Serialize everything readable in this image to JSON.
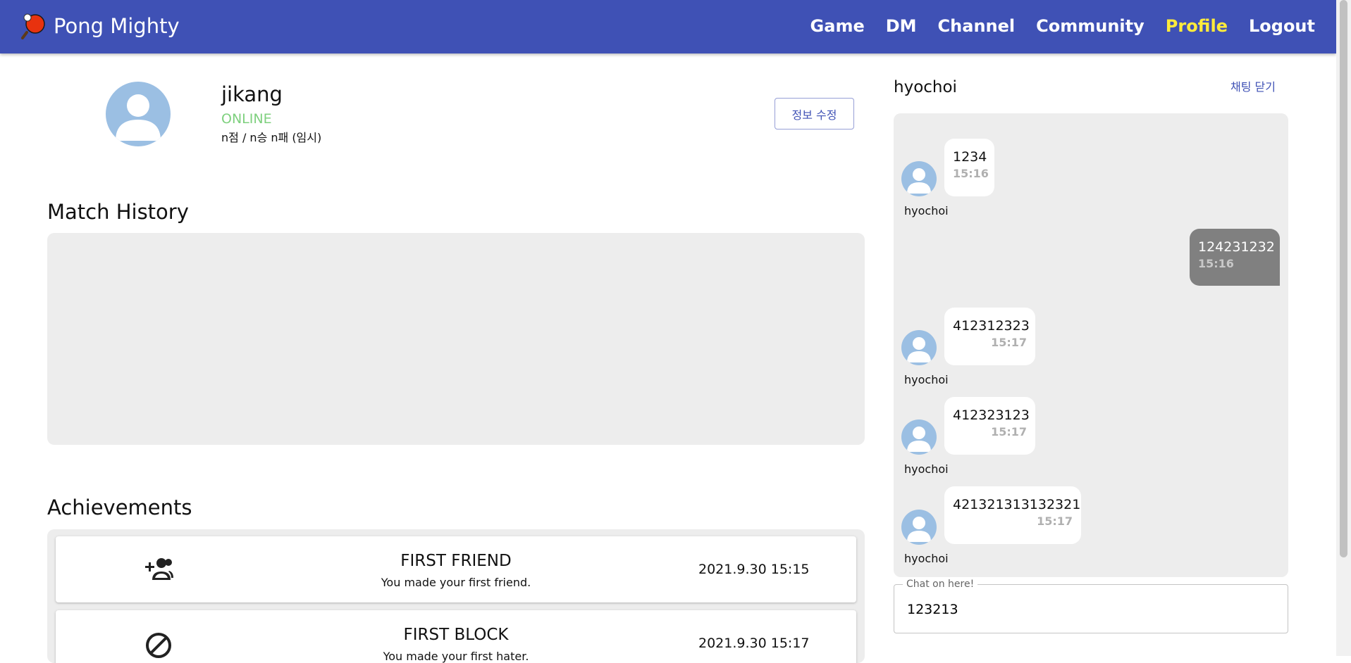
{
  "header": {
    "brand": "Pong Mighty",
    "nav": [
      "Game",
      "DM",
      "Channel",
      "Community",
      "Profile",
      "Logout"
    ],
    "active": "Profile",
    "active_color": "#ffeb3b",
    "bg_color": "#3f51b5"
  },
  "profile": {
    "username": "jikang",
    "status": "ONLINE",
    "record": "n점 / n승 n패 (임시)",
    "edit_label": "정보 수정"
  },
  "match_history": {
    "title": "Match History"
  },
  "achievements": {
    "title": "Achievements",
    "items": [
      {
        "title": "FIRST FRIEND",
        "desc": "You made your first friend.",
        "date": "2021.9.30 15:15",
        "icon": "person-add-icon"
      },
      {
        "title": "FIRST BLOCK",
        "desc": "You made your first hater.",
        "date": "2021.9.30 15:17",
        "icon": "block-icon"
      }
    ]
  },
  "chat": {
    "partner": "hyochoi",
    "close_label": "채팅 닫기",
    "messages": [
      {
        "text": "1234",
        "time": "15:16",
        "mine": false,
        "sender": "hyochoi"
      },
      {
        "text": "124231232",
        "time": "15:16",
        "mine": true,
        "sender": ""
      },
      {
        "text": "412312323",
        "time": "15:17",
        "mine": false,
        "sender": "hyochoi"
      },
      {
        "text": "412323123",
        "time": "15:17",
        "mine": false,
        "sender": "hyochoi"
      },
      {
        "text": "421321313132321",
        "time": "15:17",
        "mine": false,
        "sender": "hyochoi"
      }
    ],
    "input_label": "Chat on here!",
    "input_value": "123213"
  }
}
